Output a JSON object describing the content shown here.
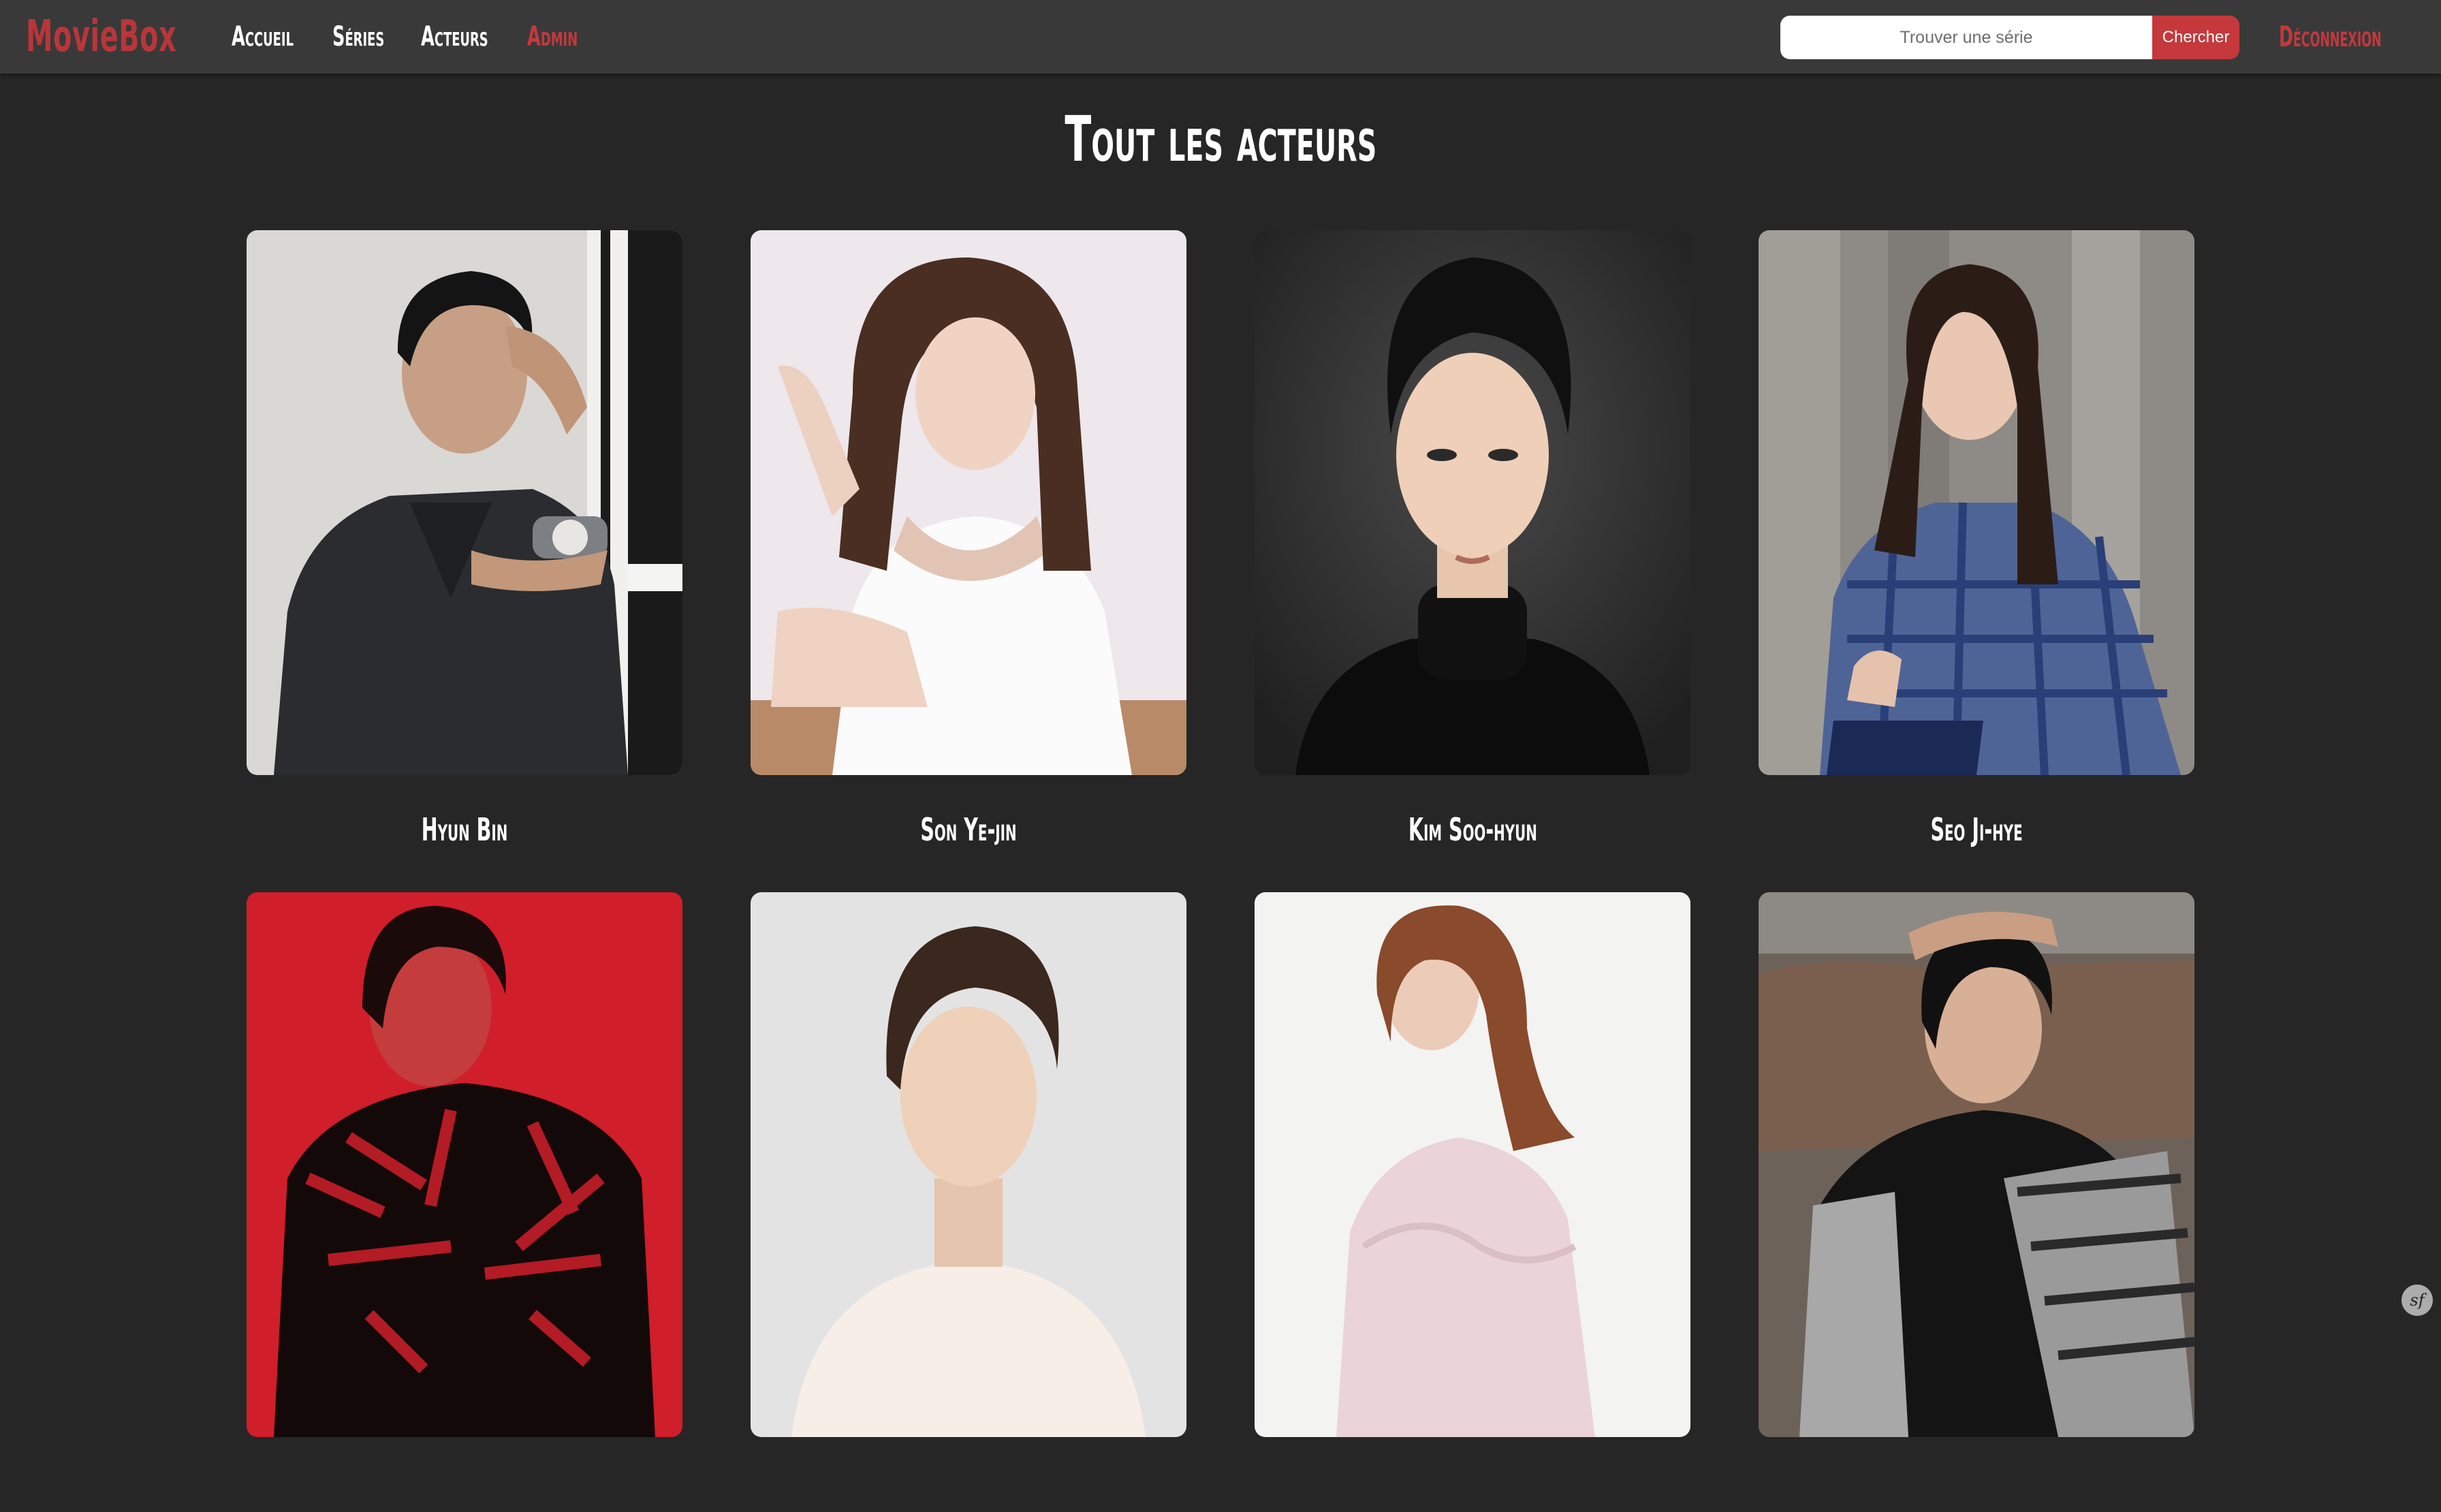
{
  "navbar": {
    "brand": "MovieBox",
    "links": [
      {
        "label": "Accueil"
      },
      {
        "label": "Séries"
      },
      {
        "label": "Acteurs"
      },
      {
        "label": "Admin"
      }
    ],
    "search": {
      "placeholder": "Trouver une série",
      "button_label": "Chercher"
    },
    "logout_label": "Déconnexion"
  },
  "page": {
    "title": "Tout les acteurs"
  },
  "actors": [
    {
      "name": "Hyun Bin"
    },
    {
      "name": "Son Ye-jin"
    },
    {
      "name": "Kim Soo-hyun"
    },
    {
      "name": "Seo Ji-hye"
    },
    {
      "name": ""
    },
    {
      "name": ""
    },
    {
      "name": ""
    },
    {
      "name": ""
    }
  ],
  "footer": {
    "symfony_badge": "sf"
  },
  "colors": {
    "background": "#262626",
    "navbar": "#393939",
    "accent": "#c2393d",
    "text": "#ffffff"
  }
}
